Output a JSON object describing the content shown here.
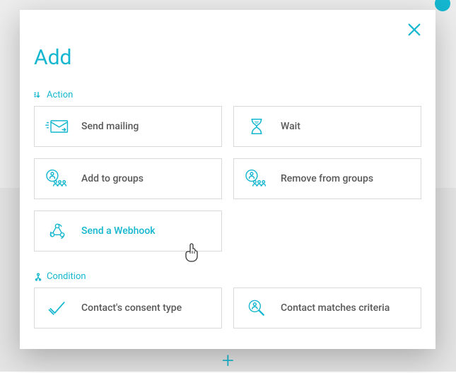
{
  "modal": {
    "title": "Add",
    "sections": {
      "action": {
        "label": "Action",
        "items": {
          "send_mailing": "Send mailing",
          "wait": "Wait",
          "add_to_groups": "Add to groups",
          "remove_from_groups": "Remove from groups",
          "send_webhook": "Send a Webhook"
        }
      },
      "condition": {
        "label": "Condition",
        "items": {
          "consent_type": "Contact's consent type",
          "matches_criteria": "Contact matches criteria"
        }
      }
    }
  }
}
